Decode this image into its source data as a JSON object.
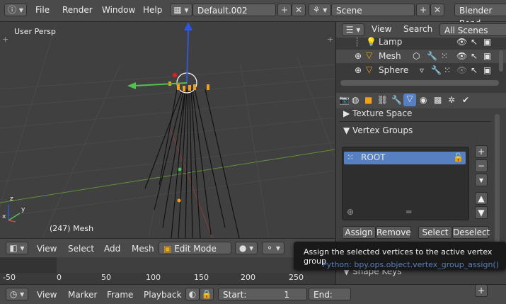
{
  "topbar": {
    "info_icon": "info-icon",
    "menus": [
      "File",
      "Render",
      "Window",
      "Help"
    ],
    "screen_layout": "Default.002",
    "scene": "Scene",
    "render_engine": "Blender Rend"
  },
  "viewport": {
    "view_label": "User Persp",
    "object_label": "(247) Mesh",
    "axis_z": "z",
    "axis_y": "y",
    "axis_x": "x"
  },
  "viewport_header": {
    "menus": [
      "View",
      "Select",
      "Add",
      "Mesh"
    ],
    "mode": "Edit Mode"
  },
  "timeline": {
    "ticks": [
      "-50",
      "0",
      "50",
      "100",
      "150",
      "200",
      "250"
    ],
    "current_frame_marker": "250"
  },
  "timebar": {
    "menus": [
      "View",
      "Marker",
      "Frame",
      "Playback"
    ],
    "start_label": "Start:",
    "start_value": "1",
    "end_label": "End:"
  },
  "outliner": {
    "menus": [
      "View",
      "Search"
    ],
    "filter": "All Scenes",
    "rows": [
      {
        "name": "Lamp"
      },
      {
        "name": "Mesh"
      },
      {
        "name": "Sphere"
      }
    ]
  },
  "properties": {
    "panels": {
      "texture_space": "Texture Space",
      "vertex_groups": "Vertex Groups",
      "shape_keys": "Shape Keys"
    },
    "vertex_groups": [
      {
        "name": "ROOT"
      }
    ],
    "buttons": {
      "assign": "Assign",
      "remove": "Remove",
      "select": "Select",
      "deselect": "Deselect"
    }
  },
  "tooltip": {
    "title": "Assign the selected vertices to the active vertex group",
    "python": "Python: bpy.ops.object.vertex_group_assign()"
  },
  "colors": {
    "accent_blue": "#5680c2",
    "axis_red": "#c84b4b",
    "axis_green": "#4fc24f",
    "axis_blue": "#2d57e0",
    "selected_orange": "#f0a020"
  }
}
